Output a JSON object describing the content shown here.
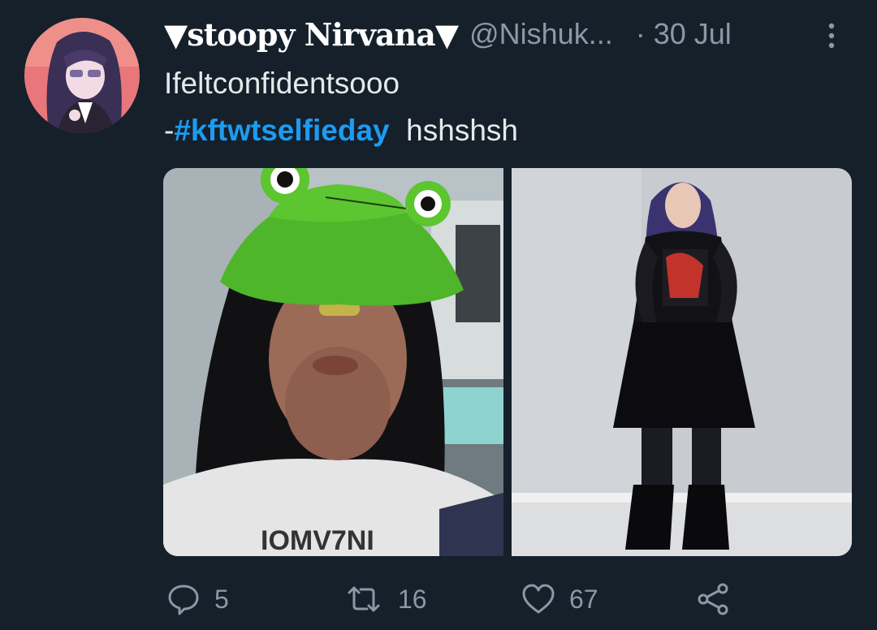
{
  "tweet": {
    "display_name": "▼stoopy Nirvana▼",
    "handle": "@Nishuk...",
    "separator": "·",
    "date": "30 Jul",
    "text_line1": "Ifeltconfidentsooo",
    "text_line2_prefix": "-",
    "hashtag": "#kftwtselfieday",
    "text_line2_suffix": "hshshsh",
    "replies": "5",
    "retweets": "16",
    "likes": "67"
  },
  "icons": {
    "more": "more-vertical-icon",
    "reply": "reply-icon",
    "retweet": "retweet-icon",
    "like": "heart-icon",
    "share": "share-icon"
  },
  "colors": {
    "background": "#15202b",
    "hashtag": "#1d9bf0",
    "muted": "#8b98a5",
    "text": "#e7e9ea"
  }
}
